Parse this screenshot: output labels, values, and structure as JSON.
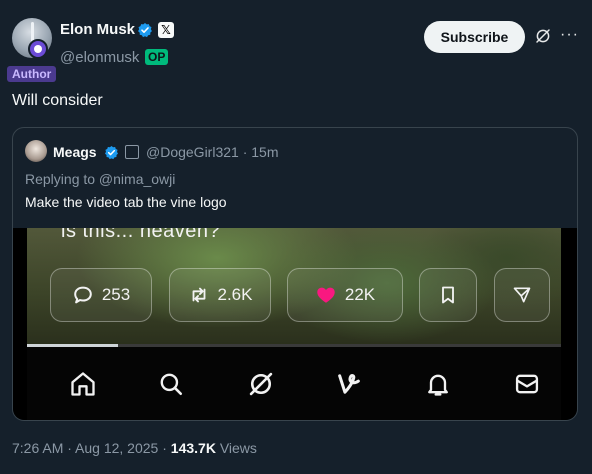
{
  "author": {
    "name": "Elon Musk",
    "handle": "@elonmusk",
    "op_badge": "OP",
    "author_label": "Author",
    "x_badge": "𝕏"
  },
  "actions": {
    "subscribe_label": "Subscribe",
    "more_label": "···"
  },
  "post": {
    "text": "Will consider"
  },
  "quote": {
    "name": "Meags",
    "handle_time": "@DogeGirl321 · 15m",
    "replying_to": "Replying to @nima_owji",
    "text": "Make the video tab the vine logo",
    "media": {
      "caption": "is this... heaven?",
      "reply_count": "253",
      "repost_count": "2.6K",
      "like_count": "22K",
      "progress": 0.17
    }
  },
  "meta": {
    "time_date": "7:26 AM · Aug 12, 2025 · ",
    "views_count": "143.7K",
    "views_label": " Views"
  },
  "colors": {
    "background": "#15202b",
    "verified": "#1d9bf0",
    "op": "#00ba7c",
    "like": "#f91880"
  }
}
